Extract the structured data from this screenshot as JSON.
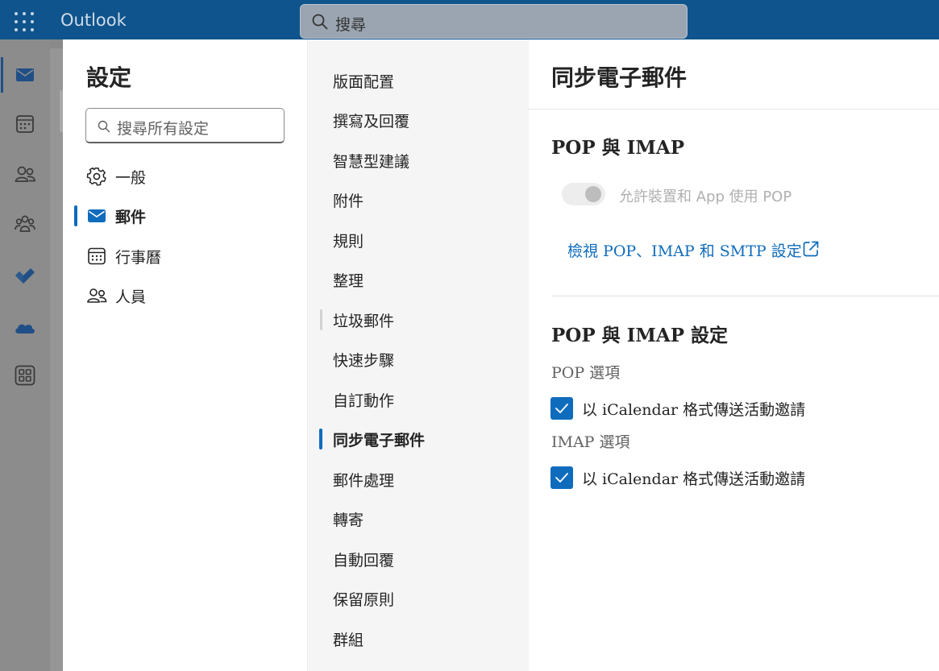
{
  "app": {
    "name": "Outlook"
  },
  "top_search": {
    "placeholder": "搜尋"
  },
  "settings": {
    "title": "設定",
    "search_placeholder": "搜尋所有設定",
    "categories": [
      {
        "label": "一般",
        "icon": "gear-icon"
      },
      {
        "label": "郵件",
        "icon": "mail-icon",
        "selected": true
      },
      {
        "label": "行事曆",
        "icon": "calendar-icon"
      },
      {
        "label": "人員",
        "icon": "people-icon"
      }
    ],
    "mail_subsections": [
      "版面配置",
      "撰寫及回覆",
      "智慧型建議",
      "附件",
      "規則",
      "整理",
      "垃圾郵件",
      "快速步驟",
      "自訂動作",
      "同步電子郵件",
      "郵件處理",
      "轉寄",
      "自動回覆",
      "保留原則",
      "群組"
    ],
    "selected_subsection": "同步電子郵件"
  },
  "pane": {
    "title": "同步電子郵件",
    "section1_title": "POP 與 IMAP",
    "pop_toggle_label": "允許裝置和 App 使用 POP",
    "pop_toggle_on": false,
    "view_settings_link": "檢視 POP、IMAP 和 SMTP 設定",
    "section2_title": "POP 與 IMAP 設定",
    "pop_options_label": "POP 選項",
    "pop_icalendar_label": "以 iCalendar 格式傳送活動邀請",
    "pop_icalendar_checked": true,
    "imap_options_label": "IMAP 選項",
    "imap_icalendar_label": "以 iCalendar 格式傳送活動邀請",
    "imap_icalendar_checked": true
  },
  "colors": {
    "brand_bar": "#0f548c",
    "accent": "#0f6cbd",
    "text": "#242424"
  }
}
